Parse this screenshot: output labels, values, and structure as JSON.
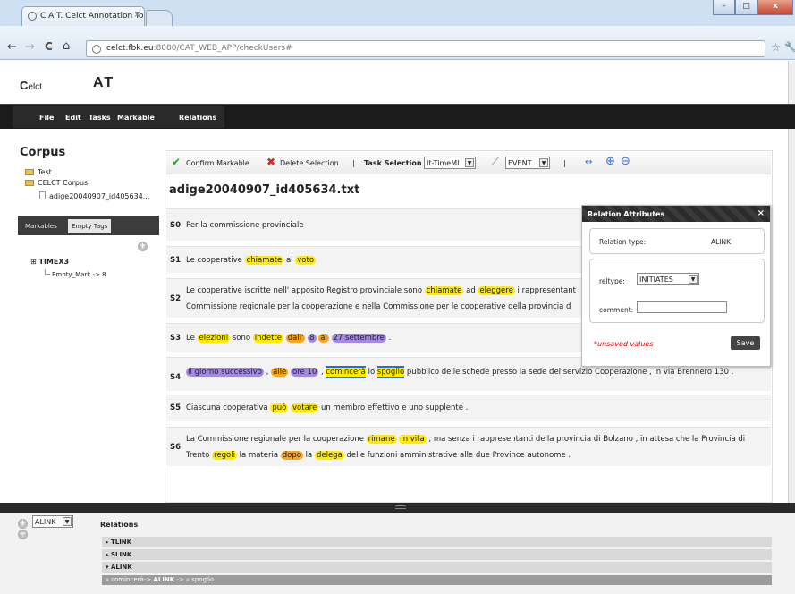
{
  "browser": {
    "tab_title": "C.A.T. Celct Annotation To",
    "tab_close": "×",
    "url_host": "celct.fbk.eu",
    "url_path": ":8080/CAT_WEB_APP/checkUsers#",
    "back": "←",
    "forward": "→",
    "reload": "C",
    "home": "⌂",
    "star": "☆",
    "wrench": "🔧",
    "win_min": "–",
    "win_max": "□",
    "win_close": "x"
  },
  "app": {
    "logo_small": "elct",
    "logo_small_C": "C",
    "logo_big": "AT"
  },
  "menu": [
    "File",
    "Edit",
    "Tasks",
    "Markable",
    "Relations"
  ],
  "sidebar": {
    "heading": "Corpus",
    "tree": [
      "Test",
      "CELCT Corpus",
      "adige20040907_id405634..."
    ],
    "tabs": [
      "Markables",
      "Empty Tags"
    ],
    "timex_label": "TIMEX3",
    "empty_mark": "Empty_Mark -> 8",
    "expand": "⊞"
  },
  "toolbar": {
    "confirm": "Confirm Markable",
    "delete": "Delete Selection",
    "sep1": "|",
    "task_label": "Task Selection",
    "task_value": "It-TimeML",
    "event_value": "EVENT",
    "sep2": "|",
    "arrow": "↔",
    "zoom_in": "⊕",
    "zoom_out": "⊖"
  },
  "document": {
    "title": "adige20040907_id405634.txt"
  },
  "relation_panel": {
    "title": "Relation Attributes",
    "close": "×",
    "type_label": "Relation type:",
    "type_value": "ALINK",
    "reltype_label": "reltype:",
    "reltype_value": "INITIATES",
    "comment_label": "comment:",
    "unsaved": "*unsaved values",
    "save": "Save"
  },
  "bottom": {
    "alink_select": "ALINK",
    "relations_label": "Relations",
    "rows": [
      "TLINK",
      "SLINK",
      "ALINK"
    ],
    "rows_arrows": [
      "▸",
      "▸",
      "▾"
    ],
    "item_parts": [
      "cominceràa",
      "-> ",
      "ALINK",
      " -> ",
      "spoglio"
    ]
  },
  "colors": {
    "event": "#ffea00",
    "signal": "#f5a623",
    "timex": "#a48ae0",
    "selected": "#1e6fd9"
  }
}
